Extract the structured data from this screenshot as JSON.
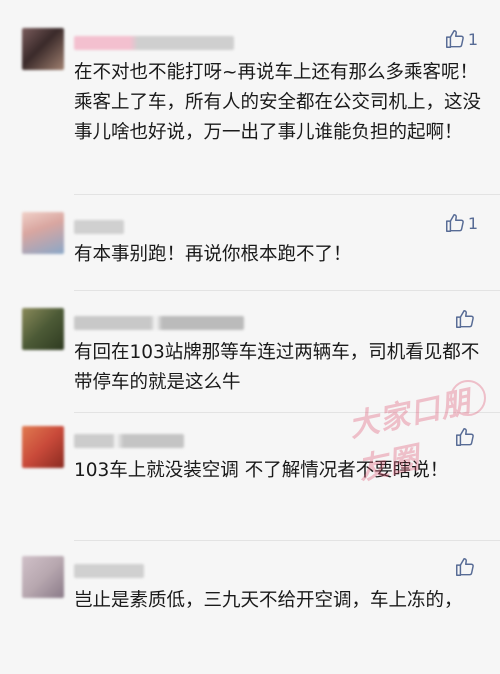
{
  "comments": [
    {
      "text": "在不对也不能打呀~再说车上还有那么多乘客呢！乘客上了车，所有人的安全都在公交司机上，这没事儿啥也好说，万一出了事儿谁能负担的起啊！",
      "likes": "1",
      "avatar_colors": [
        "#7a5c5c",
        "#3a2a2a",
        "#a08070"
      ],
      "name_blur_colors": [
        "#f3c0cf",
        "#cfcfcf"
      ]
    },
    {
      "text": "有本事别跑！再说你根本跑不了！",
      "likes": "1",
      "avatar_colors": [
        "#d9a6a0",
        "#8aa7c8",
        "#f0d0c8"
      ],
      "name_blur_colors": [
        "#d0d0d0",
        "#d8d8d8"
      ]
    },
    {
      "text": "有回在103站牌那等车连过两辆车，司机看见都不带停车的就是这么牛",
      "likes": "",
      "avatar_colors": [
        "#4c5a36",
        "#8a8a5a",
        "#2e3a20"
      ],
      "name_blur_colors": [
        "#c8c8c8",
        "#bbbbbb"
      ]
    },
    {
      "text": "103车上就没装空调 不了解情况者不要瞎说！",
      "likes": "",
      "avatar_colors": [
        "#c94a3a",
        "#e07a50",
        "#8a2a20"
      ],
      "name_blur_colors": [
        "#cccccc",
        "#c4c4c4"
      ]
    },
    {
      "text": "岂止是素质低，三九天不给开空调，车上冻的，",
      "likes": "",
      "avatar_colors": [
        "#b8a8b0",
        "#8a7a88",
        "#d0c0c8"
      ],
      "name_blur_colors": [
        "#d0d0d0",
        "#c8c8c8"
      ]
    }
  ],
  "watermark": {
    "text": "大家口朋友圈",
    "color": "#e05a76"
  },
  "icons": {
    "like": "thumbs-up-icon"
  }
}
